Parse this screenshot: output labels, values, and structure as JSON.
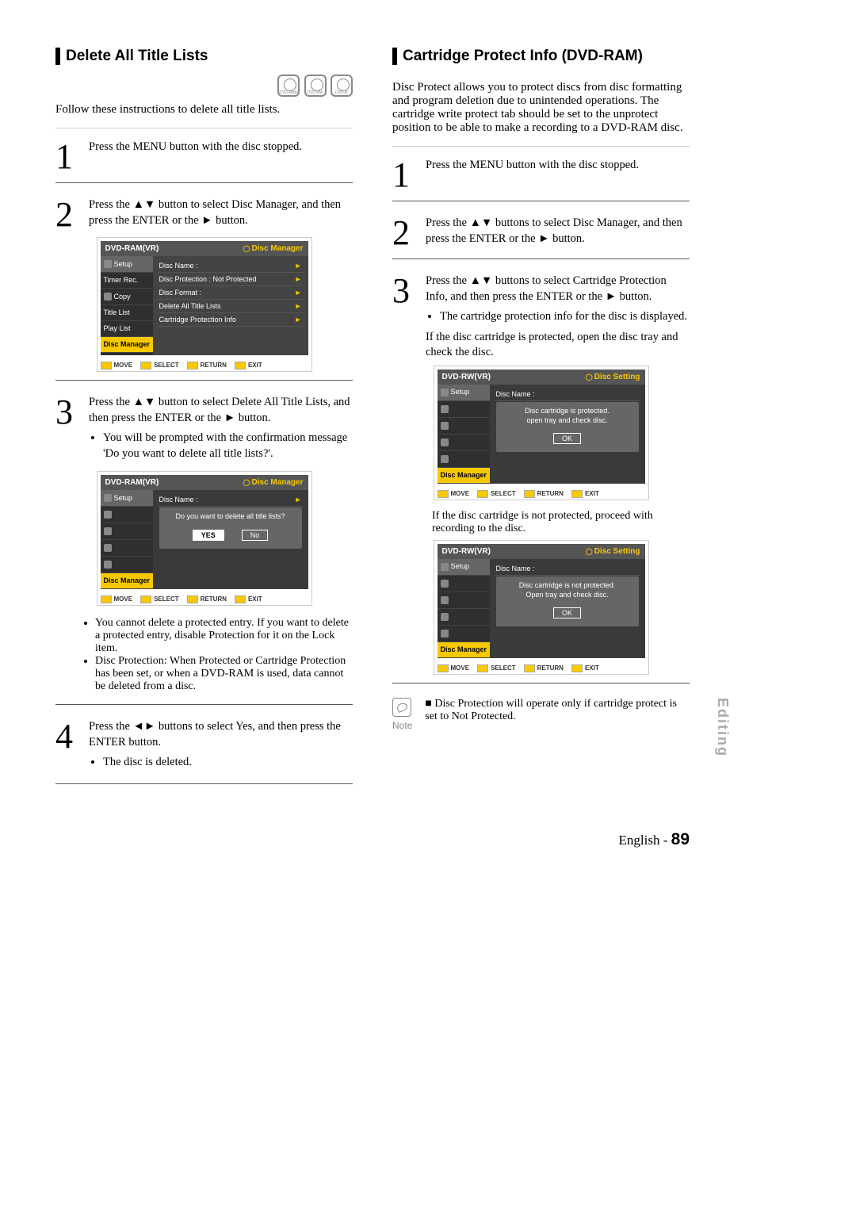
{
  "left": {
    "title": "Delete All Title Lists",
    "disc_types": [
      "DVD-RAM",
      "DVD-RW",
      "DVD-R"
    ],
    "intro": "Follow these instructions to delete all title lists.",
    "steps": {
      "s1": "Press the MENU button with the disc stopped.",
      "s2": "Press the ▲▼ button to select Disc Manager, and then press the ENTER or the ► button.",
      "s3": "Press the ▲▼ button to select Delete All Title Lists, and then press the ENTER or the ► button.",
      "s3_b1": "You will be prompted with the confirmation message 'Do you want to delete all title lists?'.",
      "s3_b2": "You cannot delete a protected entry. If you want to delete a protected entry, disable Protection for it on the Lock item.",
      "s3_b3": "Disc Protection: When Protected or Cartridge Protection has been set, or when a DVD-RAM is used, data cannot be deleted from a disc.",
      "s4": "Press the ◄► buttons to select Yes, and then press the ENTER button.",
      "s4_b1": "The disc is deleted."
    },
    "osd1": {
      "mode": "DVD-RAM(VR)",
      "panel": "Disc Manager",
      "menu": [
        "Setup",
        "Timer Rec.",
        "Copy",
        "Title List",
        "Play List",
        "Disc Manager"
      ],
      "items": [
        "Disc Name    :",
        "Disc Protection : Not Protected",
        "Disc Format   :",
        "Delete All Title Lists",
        "Cartridge Protection Info"
      ],
      "footer": [
        "MOVE",
        "SELECT",
        "RETURN",
        "EXIT"
      ]
    },
    "osd2": {
      "mode": "DVD-RAM(VR)",
      "panel": "Disc Manager",
      "main_label": "Disc Name   :",
      "dialog": "Do you want to delete all title lists?",
      "yes": "YES",
      "no": "No",
      "bottom_label": "Disc Manager",
      "footer": [
        "MOVE",
        "SELECT",
        "RETURN",
        "EXIT"
      ]
    }
  },
  "right": {
    "title": "Cartridge Protect Info (DVD-RAM)",
    "intro": "Disc Protect allows you to protect discs from disc formatting and program deletion due to unintended operations. The cartridge write protect tab should be set to the unprotect position to be able to make a recording to a DVD-RAM disc.",
    "steps": {
      "s1": "Press the MENU button with the disc stopped.",
      "s2": "Press the ▲▼ buttons to select Disc Manager, and then press the ENTER or the ► button.",
      "s3": "Press the ▲▼ buttons to select Cartridge Protection Info, and then press the ENTER or the ► button.",
      "s3_b1": "The cartridge protection info for the disc is displayed.",
      "s3_after1": "If the disc cartridge is protected, open the disc tray and check the disc.",
      "s3_after2": "If the disc cartridge is not protected, proceed with recording to the disc."
    },
    "osd1": {
      "mode": "DVD-RW(VR)",
      "panel": "Disc Setting",
      "main_label": "Disc Name   :",
      "dialog1": "Disc cartridge is protected.",
      "dialog2": "open tray and check disc.",
      "ok": "OK",
      "bottom_label": "Disc Manager",
      "footer": [
        "MOVE",
        "SELECT",
        "RETURN",
        "EXIT"
      ]
    },
    "osd2": {
      "mode": "DVD-RW(VR)",
      "panel": "Disc Setting",
      "main_label": "Disc Name   :",
      "dialog1": "Disc cartridge is not protected.",
      "dialog2": "Open tray and check disc.",
      "ok": "OK",
      "bottom_label": "Disc Manager",
      "footer": [
        "MOVE",
        "SELECT",
        "RETURN",
        "EXIT"
      ]
    },
    "note_label": "Note",
    "note_text": "Disc Protection will operate only if cartridge protect is set to Not Protected."
  },
  "side_label": "Editing",
  "footer_lang": "English - ",
  "footer_page": "89"
}
